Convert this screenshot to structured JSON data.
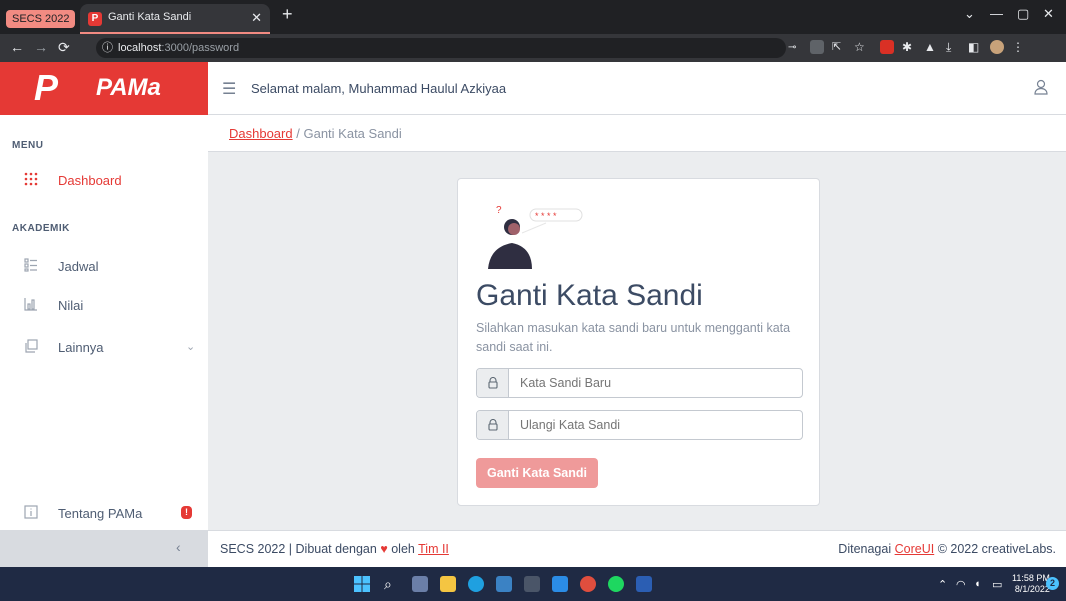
{
  "browser": {
    "group_label": "SECS 2022",
    "tab_title": "Ganti Kata Sandi",
    "url_host": "localhost",
    "url_rest": ":3000/password"
  },
  "brand": {
    "name": "PAMa"
  },
  "header": {
    "greeting": "Selamat malam, Muhammad Haulul Azkiyaa"
  },
  "breadcrumb": {
    "link": "Dashboard",
    "separator": "/",
    "current": "Ganti Kata Sandi"
  },
  "sidebar": {
    "menu_title": "MENU",
    "academic_title": "AKADEMIK",
    "items": [
      {
        "label": "Dashboard"
      },
      {
        "label": "Jadwal"
      },
      {
        "label": "Nilai"
      },
      {
        "label": "Lainnya"
      }
    ],
    "about_label": "Tentang PAMa",
    "about_badge": "!"
  },
  "card": {
    "illustration_text": "* * * *",
    "title": "Ganti Kata Sandi",
    "description": "Silahkan masukan kata sandi baru untuk mengganti kata sandi saat ini.",
    "new_password_placeholder": "Kata Sandi Baru",
    "repeat_password_placeholder": "Ulangi Kata Sandi",
    "submit_label": "Ganti Kata Sandi"
  },
  "footer": {
    "left_prefix": "SECS 2022 | Dibuat dengan",
    "left_by": "oleh",
    "team_link": "Tim II",
    "right_prefix": "Ditenagai",
    "powered_link": "CoreUI",
    "right_suffix": "© 2022 creativeLabs."
  },
  "taskbar": {
    "time": "11:58 PM",
    "date": "8/1/2022",
    "notif_count": "2"
  },
  "colors": {
    "brand": "#e53935",
    "button": "#ef9a9a",
    "sidebar_icon": "#9da5b1"
  }
}
